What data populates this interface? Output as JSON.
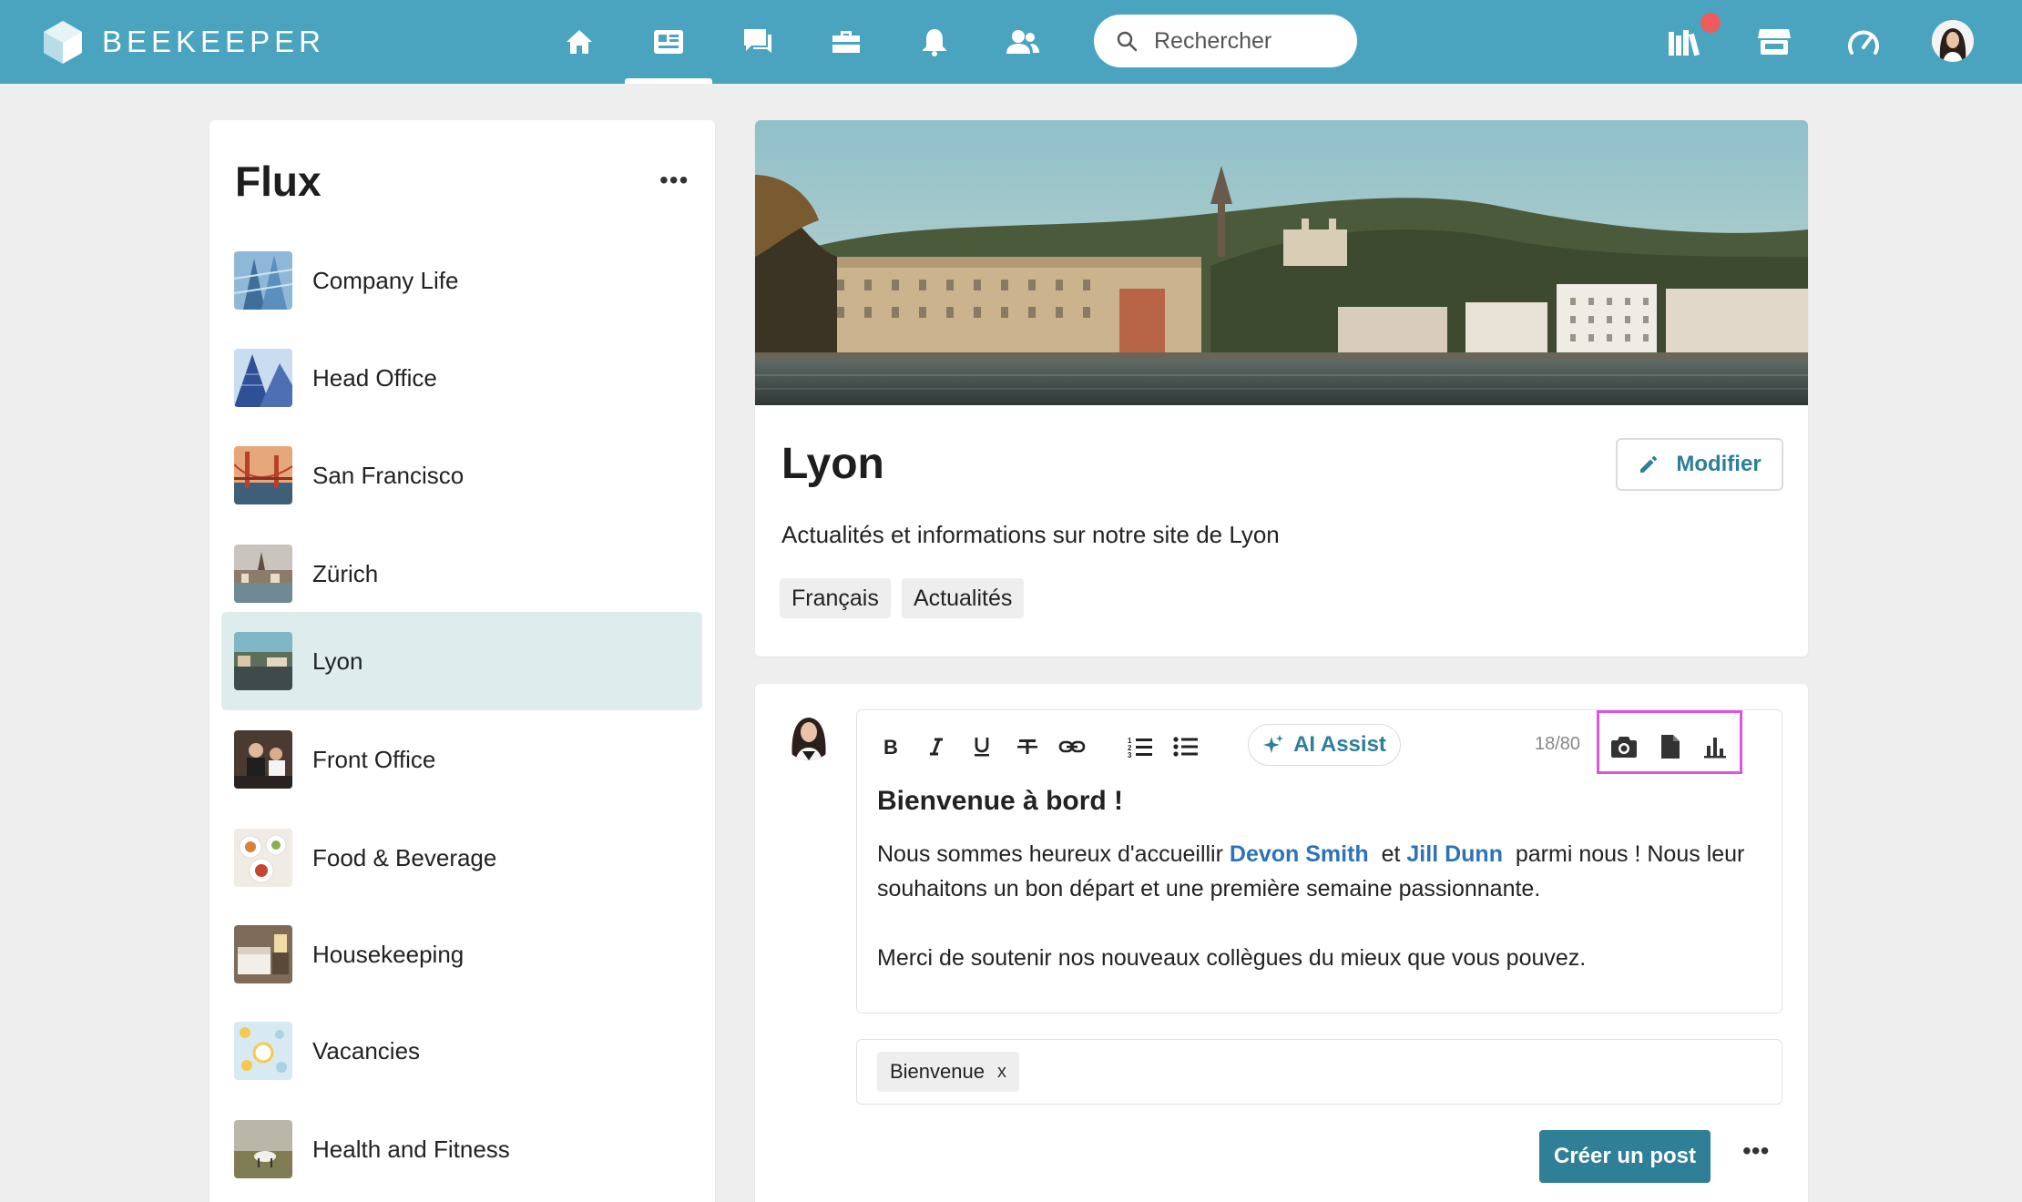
{
  "app": {
    "brand": "BEEKEEPER",
    "search_placeholder": "Rechercher"
  },
  "nav": {
    "icons": [
      "home-icon",
      "newsfeed-icon",
      "chat-icon",
      "toolbox-icon",
      "bell-icon",
      "people-icon"
    ],
    "active": "newsfeed-icon",
    "right_icons": [
      "library-icon",
      "marketplace-icon",
      "dashboard-icon"
    ],
    "notification_badge_color": "#ef5b5b"
  },
  "colors": {
    "topbar": "#4ba4bf",
    "accent": "#2f7f97",
    "active_item_bg": "#deecee",
    "mention": "#2e73b8",
    "highlight_box": "#e052e6"
  },
  "sidebar": {
    "title": "Flux",
    "items": [
      {
        "label": "Company Life"
      },
      {
        "label": "Head Office"
      },
      {
        "label": "San Francisco"
      },
      {
        "label": "Zürich"
      },
      {
        "label": "Lyon",
        "active": true
      },
      {
        "label": "Front Office"
      },
      {
        "label": "Food & Beverage"
      },
      {
        "label": "Housekeeping"
      },
      {
        "label": "Vacancies"
      },
      {
        "label": "Health and Fitness"
      }
    ]
  },
  "channel": {
    "title": "Lyon",
    "description": "Actualités et informations sur notre site de Lyon",
    "edit_label": "Modifier",
    "tags": [
      "Français",
      "Actualités"
    ]
  },
  "composer": {
    "ai_assist_label": "AI Assist",
    "char_count": "18/80",
    "post_title": "Bienvenue à bord !",
    "body_intro": "Nous sommes heureux d'accueillir",
    "mention_1": "Devon Smith",
    "body_and": "et",
    "mention_2": "Jill Dunn",
    "body_rest": "parmi nous ! Nous leur souhaitons un bon départ et une première semaine passionnante.",
    "body_line_2": "Merci de soutenir nos nouveaux collègues du mieux que vous pouvez.",
    "tag": "Bienvenue",
    "tag_remove": "x",
    "submit_label": "Créer un post"
  }
}
